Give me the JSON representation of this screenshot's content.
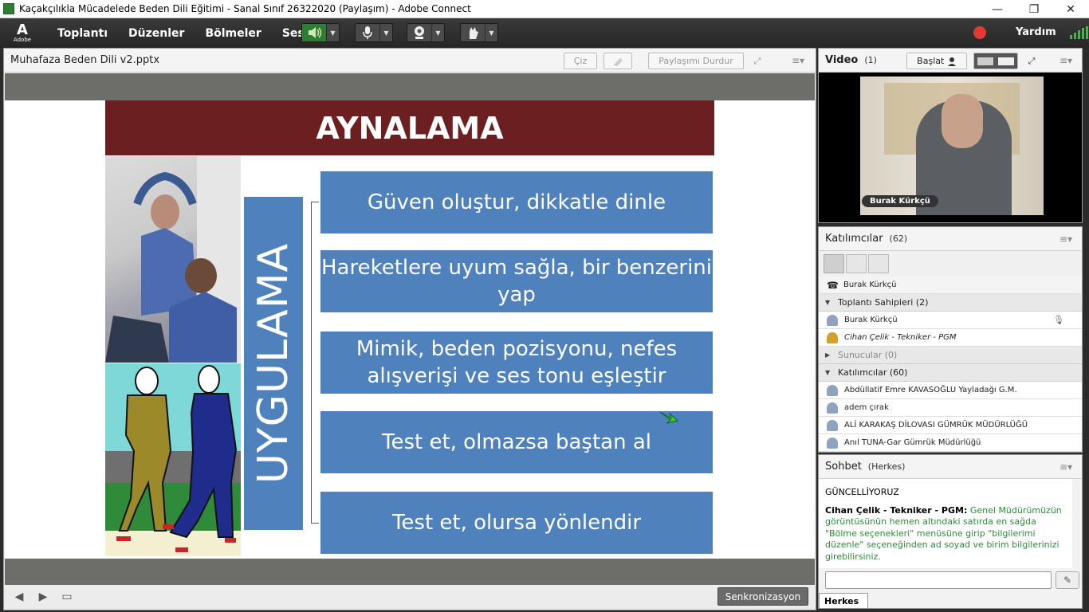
{
  "window": {
    "title": "Kaçakçılıkla Mücadelede Beden Dili Eğitimi - Sanal Sınıf  26322020 (Paylaşım) - Adobe Connect",
    "minimize": "—",
    "restore": "❐",
    "close": "✕"
  },
  "menubar": {
    "logo_text": "Adobe",
    "items": [
      "Toplantı",
      "Düzenler",
      "Bölmeler",
      "Ses"
    ],
    "help": "Yardım"
  },
  "share_pod": {
    "title": "Muhafaza Beden Dili v2.pptx",
    "draw_label": "Çiz",
    "stop_share_label": "Paylaşımı Durdur",
    "sync_label": "Senkronizasyon",
    "slide": {
      "title": "AYNALAMA",
      "side_label": "UYGULAMA",
      "boxes": [
        "Güven oluştur, dikkatle dinle",
        "Hareketlere uyum sağla, bir benzerini yap",
        "Mimik, beden pozisyonu, nefes alışverişi ve ses tonu eşleştir",
        "Test et, olmazsa baştan al",
        "Test et, olursa yönlendir"
      ]
    }
  },
  "video_pod": {
    "title": "Video",
    "count": "(1)",
    "start_label": "Başlat",
    "presenter_name": "Burak Kürkçü"
  },
  "attendees_pod": {
    "title": "Katılımcılar",
    "count": "(62)",
    "top_user": "Burak Kürkçü",
    "hosts_group": "Toplantı Sahipleri (2)",
    "hosts": [
      "Burak Kürkçü",
      "Cihan Çelik - Tekniker - PGM"
    ],
    "presenters_group": "Sunucular (0)",
    "participants_group": "Katılımcılar (60)",
    "participants": [
      "Abdüllatif Emre KAVASOĞLU Yayladağı G.M.",
      "adem çırak",
      "ALİ KARAKAŞ DİLOVASI GÜMRÜK MÜDÜRLÜĞÜ",
      "Anıl TUNA-Gar Gümrük Müdürlüğü"
    ]
  },
  "chat_pod": {
    "title": "Sohbet",
    "scope": "(Herkes)",
    "messages": [
      {
        "text": "GÜNCELLİYORUZ"
      },
      {
        "sender": "Cihan Çelik - Tekniker - PGM:",
        "text": "Genel Müdürümüzün görüntüsünün hemen altındaki satırda en sağda \"Bölme seçenekleri\" menüsüne girip \"bilgilerimi düzenle\" seçeneğinden ad soyad ve birim bilgilerinizi girebilirsiniz."
      }
    ],
    "tab_label": "Herkes"
  },
  "colors": {
    "slide_title_bg": "#6b1f20",
    "slide_box": "#4f81bd",
    "chat_green": "#2e8b3a",
    "record": "#e53935"
  }
}
